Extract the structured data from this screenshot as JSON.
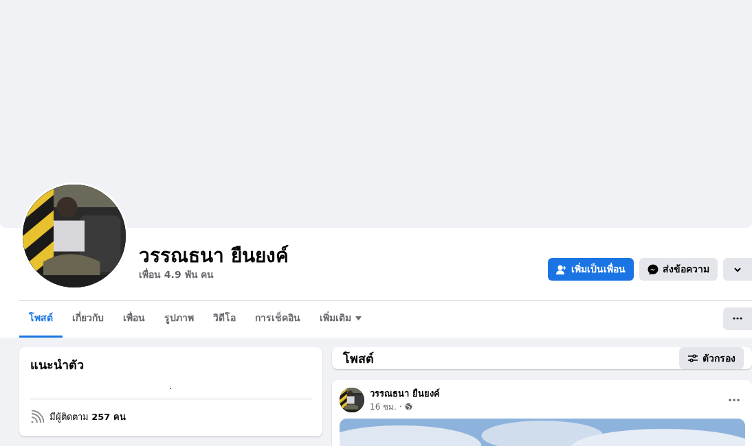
{
  "profile": {
    "name": "วรรณธนา ยืนยงค์",
    "friends": "เพื่อน 4.9 พัน คน"
  },
  "actions": [
    {
      "kind": "add-friend",
      "label": "เพิ่มเป็นเพื่อน"
    },
    {
      "kind": "message",
      "label": "ส่งข้อความ"
    },
    {
      "kind": "more"
    }
  ],
  "tabs": [
    {
      "label": "โพสต์",
      "selected": true
    },
    {
      "label": "เกี่ยวกับ",
      "selected": false
    },
    {
      "label": "เพื่อน",
      "selected": false
    },
    {
      "label": "รูปภาพ",
      "selected": false
    },
    {
      "label": "วิดีโอ",
      "selected": false
    },
    {
      "label": "การเช็คอิน",
      "selected": false
    },
    {
      "label": "เพิ่มเติม",
      "selected": false,
      "dropdown": true
    }
  ],
  "intro": {
    "title": "แนะนำตัว",
    "bio": ".",
    "followers": "มีผู้ติดตาม **257 คน**"
  },
  "posts_header": {
    "title": "โพสต์",
    "filter": "ตัวกรอง"
  },
  "post": {
    "author": "วรรณธนา ยืนยงค์",
    "time": "16 ชม. ·"
  }
}
